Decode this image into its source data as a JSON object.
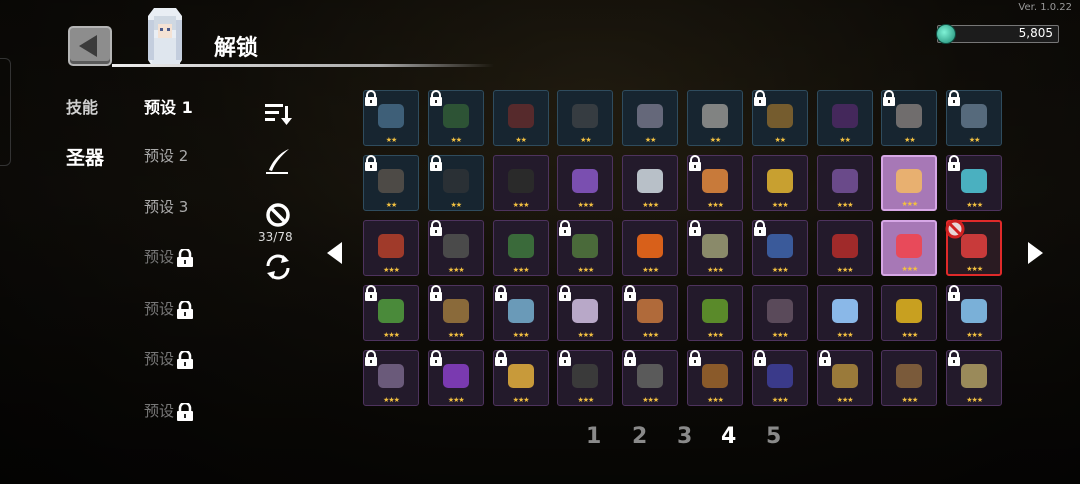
{
  "version": "Ver. 1.0.22",
  "header": {
    "title": "解锁",
    "currency_value": "5,805"
  },
  "categories": [
    {
      "label": "技能",
      "active": false
    },
    {
      "label": "圣器",
      "active": true
    }
  ],
  "presets": [
    {
      "label": "预设 1",
      "locked": false,
      "active": true
    },
    {
      "label": "预设 2",
      "locked": false,
      "active": false
    },
    {
      "label": "预设 3",
      "locked": false,
      "active": false
    },
    {
      "label": "预设",
      "locked": true,
      "active": false
    },
    {
      "label": "预设",
      "locked": true,
      "active": false
    },
    {
      "label": "预设",
      "locked": true,
      "active": false
    },
    {
      "label": "预设",
      "locked": true,
      "active": false
    }
  ],
  "tools": {
    "count": "33/78"
  },
  "pagination": {
    "pages": [
      "1",
      "2",
      "3",
      "4",
      "5"
    ],
    "current": "4"
  },
  "grid": {
    "rows": [
      [
        {
          "stars": "★★",
          "rarity": 2,
          "locked": true,
          "icon": "crystal-cluster",
          "color": "#5f8fb5"
        },
        {
          "stars": "★★",
          "rarity": 2,
          "locked": true,
          "icon": "green-egg",
          "color": "#3f7a3a"
        },
        {
          "stars": "★★",
          "rarity": 2,
          "locked": false,
          "icon": "red-egg",
          "color": "#8a2f2a"
        },
        {
          "stars": "★★",
          "rarity": 2,
          "locked": false,
          "icon": "dark-key",
          "color": "#505050"
        },
        {
          "stars": "★★",
          "rarity": 2,
          "locked": false,
          "icon": "sparkle-orb",
          "color": "#a6a0b8"
        },
        {
          "stars": "★★",
          "rarity": 2,
          "locked": false,
          "icon": "letter-envelope",
          "color": "#d9d2c6"
        },
        {
          "stars": "★★",
          "rarity": 2,
          "locked": true,
          "icon": "gold-ring",
          "color": "#c28a2e"
        },
        {
          "stars": "★★",
          "rarity": 2,
          "locked": false,
          "icon": "purple-jewel",
          "color": "#6a2b80"
        },
        {
          "stars": "★★",
          "rarity": 2,
          "locked": true,
          "icon": "pearl-shell",
          "color": "#b9a9a0"
        },
        {
          "stars": "★★",
          "rarity": 2,
          "locked": true,
          "icon": "ice-shard",
          "color": "#8aa4bb"
        }
      ],
      [
        {
          "stars": "★★",
          "rarity": 2,
          "locked": true,
          "icon": "wooden-stick",
          "color": "#7a6a5a"
        },
        {
          "stars": "★★",
          "rarity": 2,
          "locked": true,
          "icon": "dark-pendant",
          "color": "#3a3a3a"
        },
        {
          "stars": "★★★",
          "rarity": 3,
          "locked": false,
          "icon": "potion-flask",
          "color": "#2a2a2a"
        },
        {
          "stars": "★★★",
          "rarity": 3,
          "locked": false,
          "icon": "purple-scroll",
          "color": "#7a4fb0"
        },
        {
          "stars": "★★★",
          "rarity": 3,
          "locked": false,
          "icon": "white-stone",
          "color": "#b8c0c8"
        },
        {
          "stars": "★★★",
          "rarity": 3,
          "locked": true,
          "icon": "dice",
          "color": "#c87a3a"
        },
        {
          "stars": "★★★",
          "rarity": 3,
          "locked": false,
          "icon": "golden-chalice",
          "color": "#c8a030"
        },
        {
          "stars": "★★★",
          "rarity": 3,
          "locked": false,
          "icon": "purple-tome",
          "color": "#6a4a8a"
        },
        {
          "stars": "★★★",
          "rarity": 3,
          "locked": false,
          "icon": "golden-shell",
          "color": "#e8b070",
          "highlight": true
        },
        {
          "stars": "★★★",
          "rarity": 3,
          "locked": true,
          "icon": "syringe",
          "color": "#4ab0c0"
        }
      ],
      [
        {
          "stars": "★★★",
          "rarity": 3,
          "locked": false,
          "icon": "red-shield",
          "color": "#a03a2a"
        },
        {
          "stars": "★★★",
          "rarity": 3,
          "locked": true,
          "icon": "iron-cross",
          "color": "#4a4a4a"
        },
        {
          "stars": "★★★",
          "rarity": 3,
          "locked": false,
          "icon": "green-tablet",
          "color": "#3a6a3a"
        },
        {
          "stars": "★★★",
          "rarity": 3,
          "locked": true,
          "icon": "green-rifle",
          "color": "#4a6a3a"
        },
        {
          "stars": "★★★",
          "rarity": 3,
          "locked": false,
          "icon": "fire-gear",
          "color": "#d8601a"
        },
        {
          "stars": "★★★",
          "rarity": 3,
          "locked": true,
          "icon": "ancient-scroll",
          "color": "#8a8a6a"
        },
        {
          "stars": "★★★",
          "rarity": 3,
          "locked": true,
          "icon": "blue-binoculars",
          "color": "#3a5a9a"
        },
        {
          "stars": "★★★",
          "rarity": 3,
          "locked": false,
          "icon": "red-flame",
          "color": "#a02a2a"
        },
        {
          "stars": "★★★",
          "rarity": 3,
          "locked": false,
          "icon": "red-egg",
          "color": "#e84a5a",
          "highlight": true
        },
        {
          "stars": "★★★",
          "rarity": 3,
          "locked": false,
          "icon": "medkit",
          "color": "#c83a3a",
          "banned": true
        }
      ],
      [
        {
          "stars": "★★★",
          "rarity": 3,
          "locked": true,
          "icon": "green-mask",
          "color": "#4a8a3a"
        },
        {
          "stars": "★★★",
          "rarity": 3,
          "locked": true,
          "icon": "drill",
          "color": "#8a6a3a"
        },
        {
          "stars": "★★★",
          "rarity": 3,
          "locked": true,
          "icon": "blue-branch",
          "color": "#6a9ab8"
        },
        {
          "stars": "★★★",
          "rarity": 3,
          "locked": true,
          "icon": "crescent-moon",
          "color": "#b8a8c8"
        },
        {
          "stars": "★★★",
          "rarity": 3,
          "locked": true,
          "icon": "leather-belt",
          "color": "#b06a3a"
        },
        {
          "stars": "★★★",
          "rarity": 3,
          "locked": false,
          "icon": "green-cloak",
          "color": "#5a8a2a"
        },
        {
          "stars": "★★★",
          "rarity": 3,
          "locked": false,
          "icon": "dark-dagger",
          "color": "#5a4a5a"
        },
        {
          "stars": "★★★",
          "rarity": 3,
          "locked": false,
          "icon": "lightning-bolt",
          "color": "#8ab8e8"
        },
        {
          "stars": "★★★",
          "rarity": 3,
          "locked": false,
          "icon": "gold-nugget",
          "color": "#c8a020"
        },
        {
          "stars": "★★★",
          "rarity": 3,
          "locked": true,
          "icon": "whirlwind",
          "color": "#7ab0d8"
        }
      ],
      [
        {
          "stars": "★★★",
          "rarity": 3,
          "locked": true,
          "icon": "broken-frame",
          "color": "#6a5a7a"
        },
        {
          "stars": "★★★",
          "rarity": 3,
          "locked": true,
          "icon": "purple-crystal",
          "color": "#7a3ab0"
        },
        {
          "stars": "★★★",
          "rarity": 3,
          "locked": true,
          "icon": "medal",
          "color": "#c89a3a"
        },
        {
          "stars": "★★★",
          "rarity": 3,
          "locked": true,
          "icon": "black-bow",
          "color": "#3a3a3a"
        },
        {
          "stars": "★★★",
          "rarity": 3,
          "locked": true,
          "icon": "horned-helmet",
          "color": "#5a5a5a"
        },
        {
          "stars": "★★★",
          "rarity": 3,
          "locked": true,
          "icon": "treasure-chest",
          "color": "#8a5a2a"
        },
        {
          "stars": "★★★",
          "rarity": 3,
          "locked": true,
          "icon": "dark-claw",
          "color": "#3a3a8a"
        },
        {
          "stars": "★★★",
          "rarity": 3,
          "locked": true,
          "icon": "bronze-gear",
          "color": "#9a7a3a"
        },
        {
          "stars": "★★★",
          "rarity": 3,
          "locked": false,
          "icon": "leather-boot",
          "color": "#7a5a3a"
        },
        {
          "stars": "★★★",
          "rarity": 3,
          "locked": true,
          "icon": "crossbow",
          "color": "#9a8a5a"
        }
      ]
    ]
  }
}
